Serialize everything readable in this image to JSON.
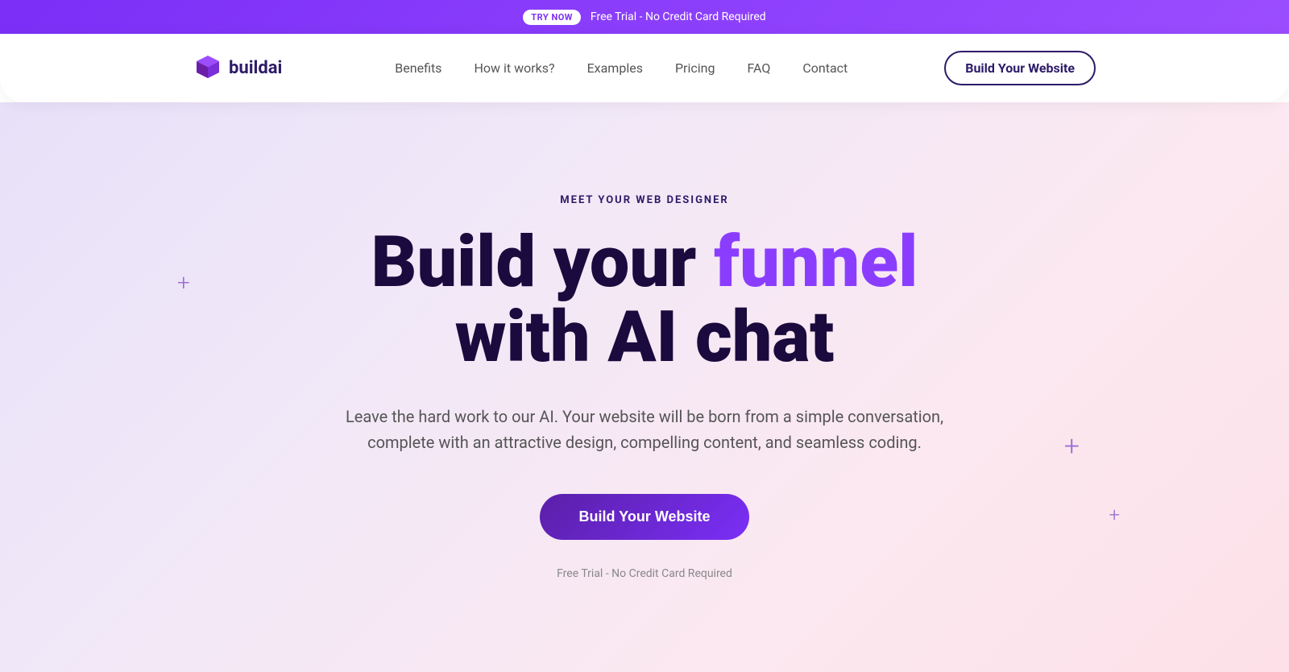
{
  "banner": {
    "badge_label": "TRY NOW",
    "banner_text": "Free Trial - No Credit Card Required"
  },
  "navbar": {
    "logo_text": "buildai",
    "nav_links": [
      {
        "label": "Benefits",
        "id": "benefits"
      },
      {
        "label": "How it works?",
        "id": "how-it-works"
      },
      {
        "label": "Examples",
        "id": "examples"
      },
      {
        "label": "Pricing",
        "id": "pricing"
      },
      {
        "label": "FAQ",
        "id": "faq"
      },
      {
        "label": "Contact",
        "id": "contact"
      }
    ],
    "cta_label": "Build Your Website"
  },
  "hero": {
    "meet_label": "MEET YOUR WEB DESIGNER",
    "title_part1": "Build your ",
    "title_highlight": "funnel",
    "title_part2": "with AI chat",
    "subtitle": "Leave the hard work to our AI. Your website will be born from a simple conversation, complete with an attractive design, compelling content, and seamless coding.",
    "cta_label": "Build Your Website",
    "free_trial_text": "Free Trial - No Credit Card Required"
  },
  "decorations": {
    "plus1": "+",
    "plus2": "+",
    "plus3": "+"
  }
}
